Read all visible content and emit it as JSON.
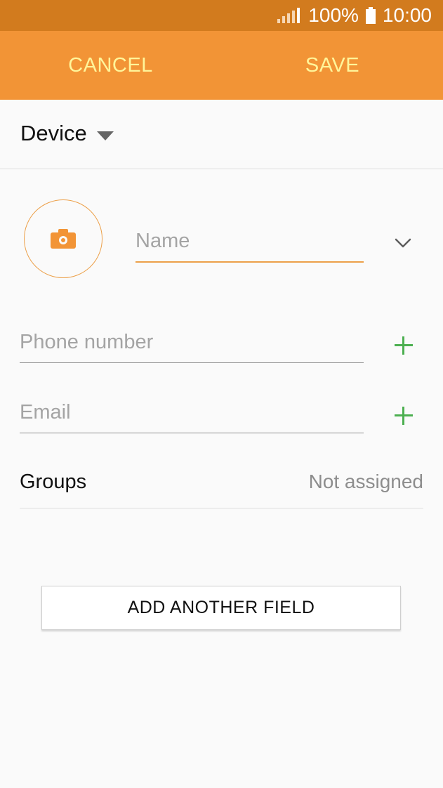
{
  "status_bar": {
    "battery_text": "100%",
    "time": "10:00",
    "icons": [
      "signal-icon",
      "battery-icon"
    ]
  },
  "app_bar": {
    "cancel_label": "CANCEL",
    "save_label": "SAVE",
    "background": "#f29436",
    "text_color": "#fff59a"
  },
  "account": {
    "label": "Device",
    "icon": "caret-down-icon"
  },
  "form": {
    "photo_icon": "camera-icon",
    "name_placeholder": "Name",
    "expand_icon": "chevron-down-icon",
    "phone_placeholder": "Phone number",
    "email_placeholder": "Email",
    "add_icon": "plus-icon",
    "groups_label": "Groups",
    "groups_value": "Not assigned",
    "add_field_label": "ADD ANOTHER FIELD"
  },
  "colors": {
    "accent": "#f29436",
    "status_bar": "#d27b1e",
    "add": "#4caf50"
  }
}
